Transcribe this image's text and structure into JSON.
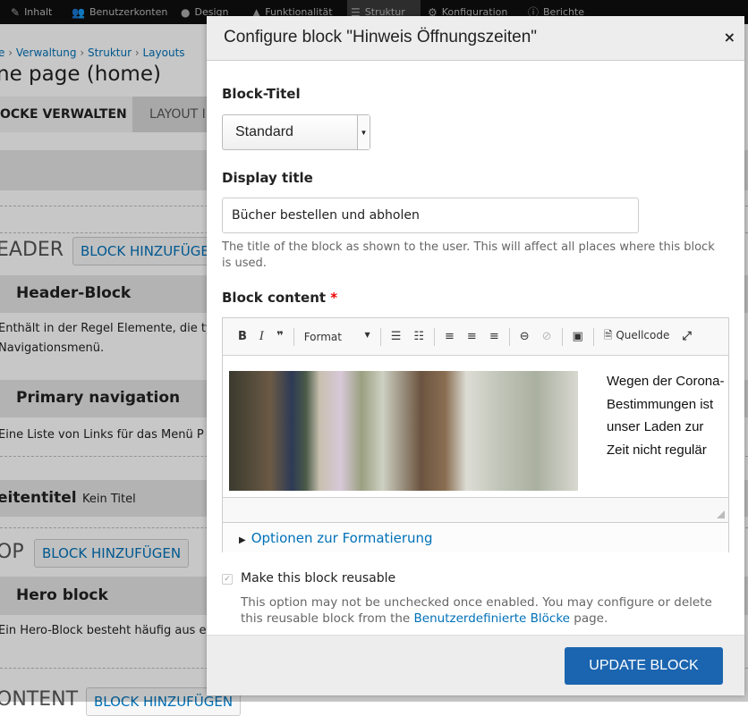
{
  "toolbar": {
    "items": [
      {
        "label": "Inhalt",
        "icon": "pencil-icon"
      },
      {
        "label": "Benutzerkonten",
        "icon": "users-icon"
      },
      {
        "label": "Design",
        "icon": "palette-icon"
      },
      {
        "label": "Funktionalität",
        "icon": "puzzle-icon"
      },
      {
        "label": "Struktur",
        "icon": "structure-icon"
      },
      {
        "label": "Konfiguration",
        "icon": "gear-icon"
      },
      {
        "label": "Berichte",
        "icon": "info-icon"
      }
    ]
  },
  "page": {
    "breadcrumb": [
      "e",
      "Verwaltung",
      "Struktur",
      "Layouts"
    ],
    "title": "ne page (home)",
    "tabs": [
      "OCKE VERWALTEN",
      "LAYOUT I"
    ],
    "regions": {
      "header": "EADER",
      "top": "OP",
      "content": "ONTENT"
    },
    "add_block": "BLOCK HINZUFÜGEN",
    "add_block_cut": "BLOCK HINZUFÜGE",
    "blocks": [
      {
        "title": "Header-Block",
        "desc1": "Enthält in der Regel Elemente, die ty",
        "desc2": "Navigationsmenü."
      },
      {
        "title": "Primary navigation",
        "desc1": "Eine Liste von Links für das Menü P"
      },
      {
        "title": "eitentitel",
        "extra": "Kein Titel"
      },
      {
        "title": "Hero block",
        "desc1": "Ein Hero-Block besteht häufig aus e"
      }
    ]
  },
  "dialog": {
    "title": "Configure block \"Hinweis Öffnungszeiten\"",
    "close": "×",
    "block_title_label": "Block-Titel",
    "block_title_value": "Standard",
    "display_title_label": "Display title",
    "display_title_value": "Bücher bestellen und abholen",
    "display_title_help": "The title of the block as shown to the user. This will affect all places where this block is used.",
    "content_label": "Block content",
    "required": "*",
    "editor": {
      "toolbar": {
        "bold": "B",
        "italic": "I",
        "quote": "❞",
        "format": "Format",
        "source": "Quellcode"
      },
      "text": "Wegen der Corona-Bestimmungen ist unser Laden zur Zeit nicht regulär"
    },
    "formatting_options": "Optionen zur Formatierung",
    "reusable_label": "Make this block reusable",
    "reusable_checked": true,
    "reusable_help_prefix": "This option may not be unchecked once enabled. You may configure or delete this reusable block from the ",
    "reusable_help_link": "Benutzerdefinierte Blöcke",
    "reusable_help_suffix": " page.",
    "update_button": "UPDATE BLOCK"
  },
  "colors": {
    "accent": "#1b65b0",
    "link": "#0071b8",
    "required": "#ee0000"
  }
}
